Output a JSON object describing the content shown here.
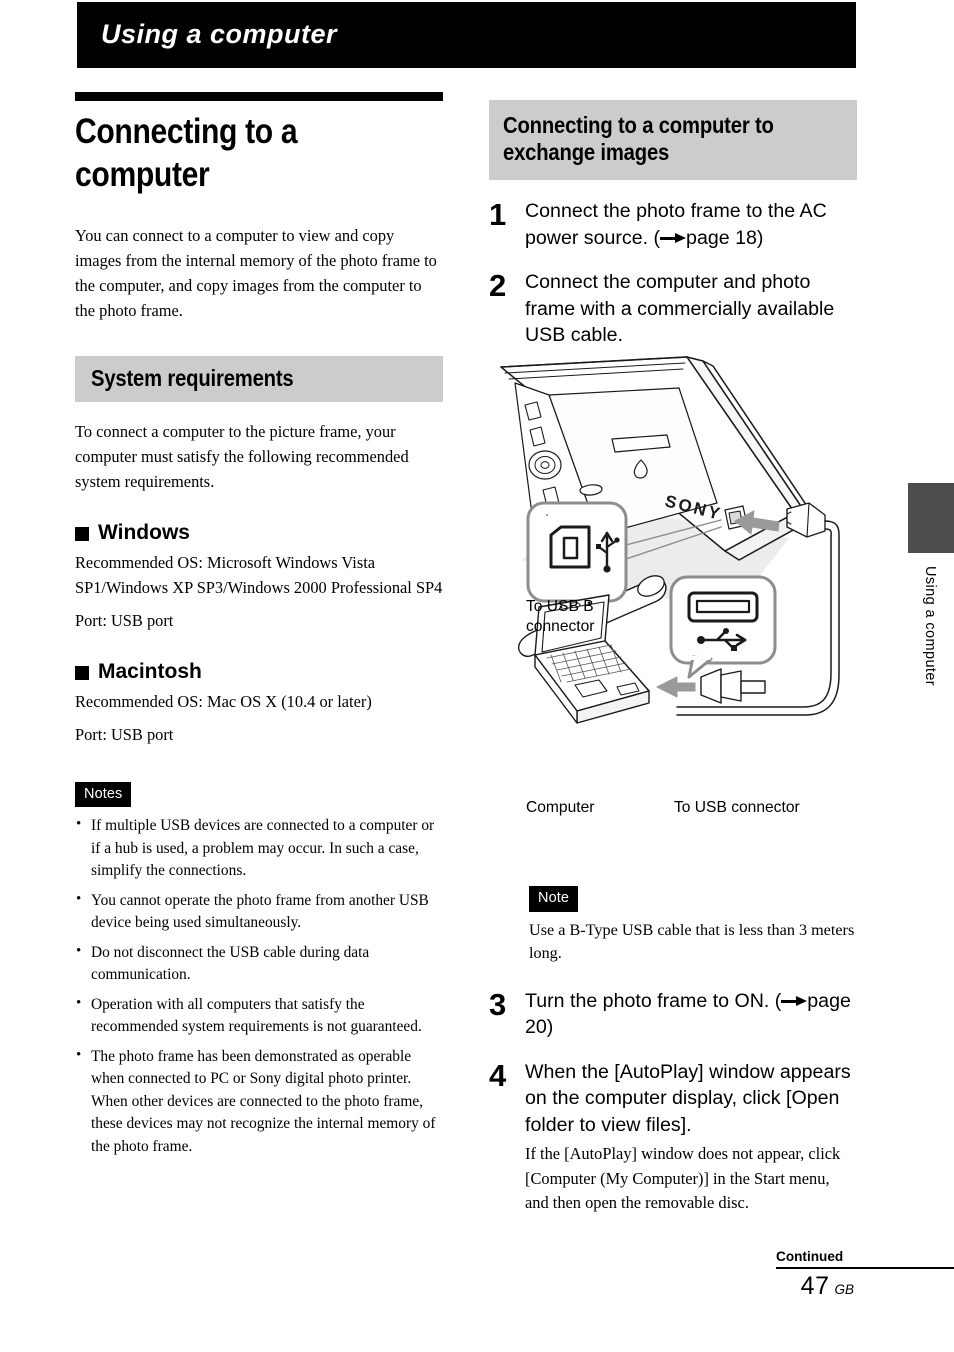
{
  "running_head": {
    "label": "Using a computer"
  },
  "left_column": {
    "chapter_title": "Connecting to a computer",
    "intro": "You can connect to a computer to view and copy images from the internal memory of the photo frame to the computer, and copy images from the computer to the photo frame.",
    "section_heading": "System requirements",
    "section_intro": "To connect a computer to the picture frame, your computer must satisfy the following recommended system requirements.",
    "windows": {
      "heading": "Windows",
      "os_line": "Recommended OS: Microsoft Windows Vista SP1/Windows XP SP3/Windows 2000 Professional SP4",
      "port_line": "Port: USB port"
    },
    "macintosh": {
      "heading": "Macintosh",
      "os_line": "Recommended OS: Mac OS X (10.4 or later)",
      "port_line": "Port: USB port"
    },
    "notes": {
      "tag": "Notes",
      "items": [
        "If multiple USB devices are connected to a computer or if a hub is used, a problem may occur. In such a case, simplify the connections.",
        "You cannot operate the photo frame from another USB device being used simultaneously.",
        "Do not disconnect the USB cable during data communication.",
        "Operation with all computers that satisfy the recommended system requirements is not guaranteed.",
        "The photo frame has been demonstrated as operable when connected to PC or Sony digital photo printer. When other devices are connected to the photo frame, these devices may not recognize the internal memory of the photo frame."
      ]
    }
  },
  "right_column": {
    "section_heading": "Connecting to a computer to exchange images",
    "steps": [
      {
        "number": "1",
        "text_before": "Connect the photo frame to the AC power source. (",
        "text_after": "page 18)"
      },
      {
        "number": "2",
        "text": "Connect the computer and photo frame with a commercially available USB cable."
      },
      {
        "number": "3",
        "text_before": "Turn the photo frame to ON. (",
        "text_after": "page 20)"
      },
      {
        "number": "4",
        "text": "When the [AutoPlay] window appears on the computer display, click [Open folder to view files].",
        "sub": "If the [AutoPlay] window does not appear, click [Computer (My Computer)] in the Start menu, and then open the removable disc."
      }
    ],
    "note": {
      "tag": "Note",
      "body": "Use a B-Type USB cable that is less than 3 meters long."
    }
  },
  "figure": {
    "brand_label": "SONY",
    "captions": {
      "usb_b": "To USB B connector",
      "computer": "Computer",
      "usb_connector": "To USB connector"
    }
  },
  "side_tab": {
    "label": "Using a computer",
    "color": "#4d4d4d"
  },
  "footer": {
    "continued": "Continued",
    "page_number": "47",
    "region": "GB"
  }
}
